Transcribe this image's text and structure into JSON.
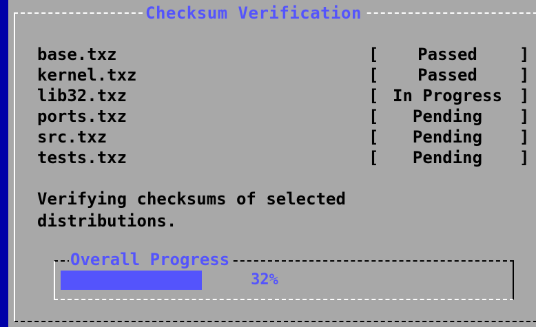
{
  "dialog": {
    "title": "Checksum Verification"
  },
  "distributions": [
    {
      "file": "base.txz",
      "open": "[",
      "status": "Passed",
      "close": "]"
    },
    {
      "file": "kernel.txz",
      "open": "[",
      "status": "Passed",
      "close": "]"
    },
    {
      "file": "lib32.txz",
      "open": "[",
      "status": "In Progress",
      "close": "]"
    },
    {
      "file": "ports.txz",
      "open": "[",
      "status": "Pending",
      "close": "]"
    },
    {
      "file": "src.txz",
      "open": "[",
      "status": "Pending",
      "close": "]"
    },
    {
      "file": "tests.txz",
      "open": "[",
      "status": "Pending",
      "close": "]"
    }
  ],
  "message": {
    "line1": "Verifying checksums of selected",
    "line2": "distributions."
  },
  "overall": {
    "title": "Overall Progress",
    "percent_label": "32%",
    "percent": 32
  },
  "colors": {
    "background": "#0000a8",
    "dialog": "#a8a8a8",
    "accent": "#5454fc"
  }
}
